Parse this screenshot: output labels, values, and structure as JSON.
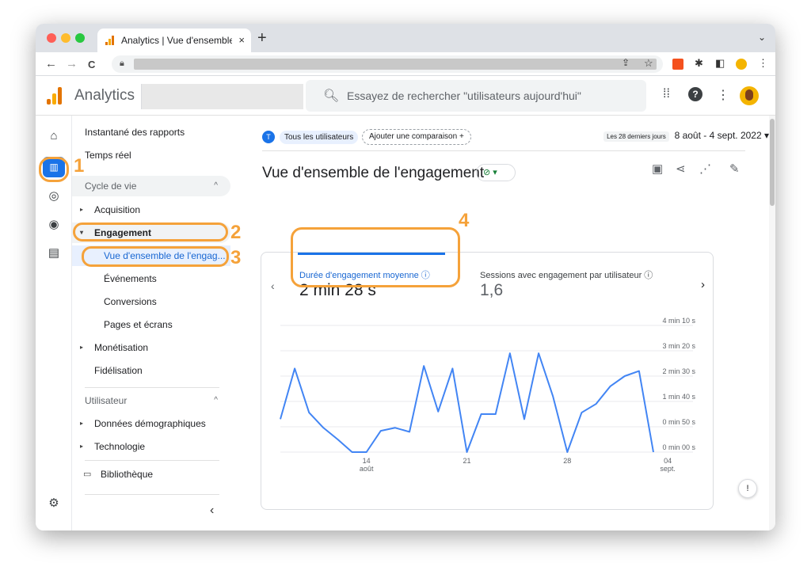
{
  "browser": {
    "tab_title": "Analytics | Vue d'ensemble de",
    "tab_close": "×",
    "new_tab": "+",
    "tab_menu": "⌄",
    "back": "←",
    "forward": "→",
    "reload": "C"
  },
  "header": {
    "brand": "Analytics",
    "search_placeholder": "Essayez de rechercher \"utilisateurs aujourd'hui\""
  },
  "sidenav": {
    "snapshot": "Instantané des rapports",
    "realtime": "Temps réel",
    "section_lifecycle": "Cycle de vie",
    "acquisition": "Acquisition",
    "engagement": "Engagement",
    "overview": "Vue d'ensemble de l'engag...",
    "events": "Événements",
    "conversions": "Conversions",
    "pages": "Pages et écrans",
    "monetization": "Monétisation",
    "retention": "Fidélisation",
    "section_user": "Utilisateur",
    "demographics": "Données démographiques",
    "technology": "Technologie",
    "library": "Bibliothèque"
  },
  "main": {
    "segment_letter": "T",
    "segment_label": "Tous les utilisateurs",
    "add_comparison": "Ajouter une comparaison +",
    "date_sub": "Les 28 derniers jours",
    "date_range": "8 août - 4 sept. 2022 ▾",
    "page_title": "Vue d'ensemble de l'engagement",
    "status_badge": "⊘ ▾",
    "metric1_label": "Durée d'engagement moyenne ⓘ",
    "metric1_value": "2 min 28 s",
    "metric2_label": "Sessions avec engagement par utilisateur ⓘ",
    "metric2_value": "1,6"
  },
  "annotations": {
    "n1": "1",
    "n2": "2",
    "n3": "3",
    "n4": "4"
  },
  "colors": {
    "accent": "#1a73e8",
    "annotation": "#f5a23a",
    "line": "#4285f4"
  },
  "chart_data": {
    "type": "line",
    "y_tick_labels": [
      "4 min 10 s",
      "3 min 20 s",
      "2 min 30 s",
      "1 min 40 s",
      "0 min 50 s",
      "0 min 00 s"
    ],
    "ylim_seconds": [
      0,
      250
    ],
    "x_tick_labels": [
      {
        "index": 6,
        "label": "14",
        "sub": "août"
      },
      {
        "index": 13,
        "label": "21",
        "sub": ""
      },
      {
        "index": 20,
        "label": "28",
        "sub": ""
      },
      {
        "index": 27,
        "label": "04",
        "sub": "sept."
      }
    ],
    "series": [
      {
        "values": [
          65,
          165,
          78,
          48,
          25,
          0,
          0,
          42,
          48,
          40,
          170,
          80,
          165,
          0,
          75,
          75,
          195,
          65,
          195,
          110,
          0,
          78,
          95,
          130,
          150,
          160,
          0
        ]
      }
    ]
  }
}
